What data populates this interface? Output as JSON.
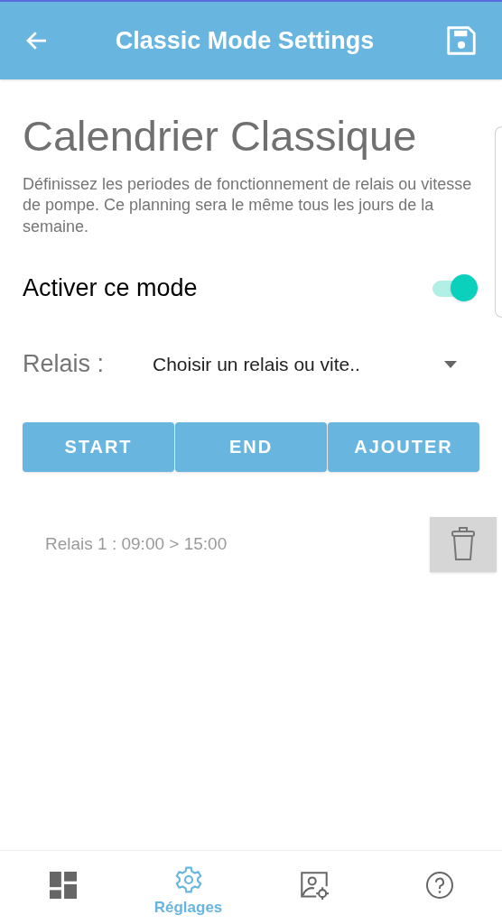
{
  "app_bar": {
    "title": "Classic Mode Settings"
  },
  "heading": "Calendrier Classique",
  "description": "Définissez les periodes de fonctionnement de relais ou vitesse de pompe. Ce planning sera le même tous les jours de la semaine.",
  "activate": {
    "label": "Activer ce mode",
    "on": true
  },
  "relay": {
    "label": "Relais :",
    "value": "Choisir un relais ou vite.."
  },
  "buttons": [
    "START",
    "END",
    "AJOUTER"
  ],
  "schedule": [
    {
      "text": "Relais 1 : 09:00 > 15:00"
    }
  ],
  "nav": [
    {
      "kind": "dashboard",
      "selected": false
    },
    {
      "kind": "settings",
      "label": "Réglages",
      "selected": true
    },
    {
      "kind": "profile",
      "selected": false
    },
    {
      "kind": "help",
      "selected": false
    }
  ]
}
